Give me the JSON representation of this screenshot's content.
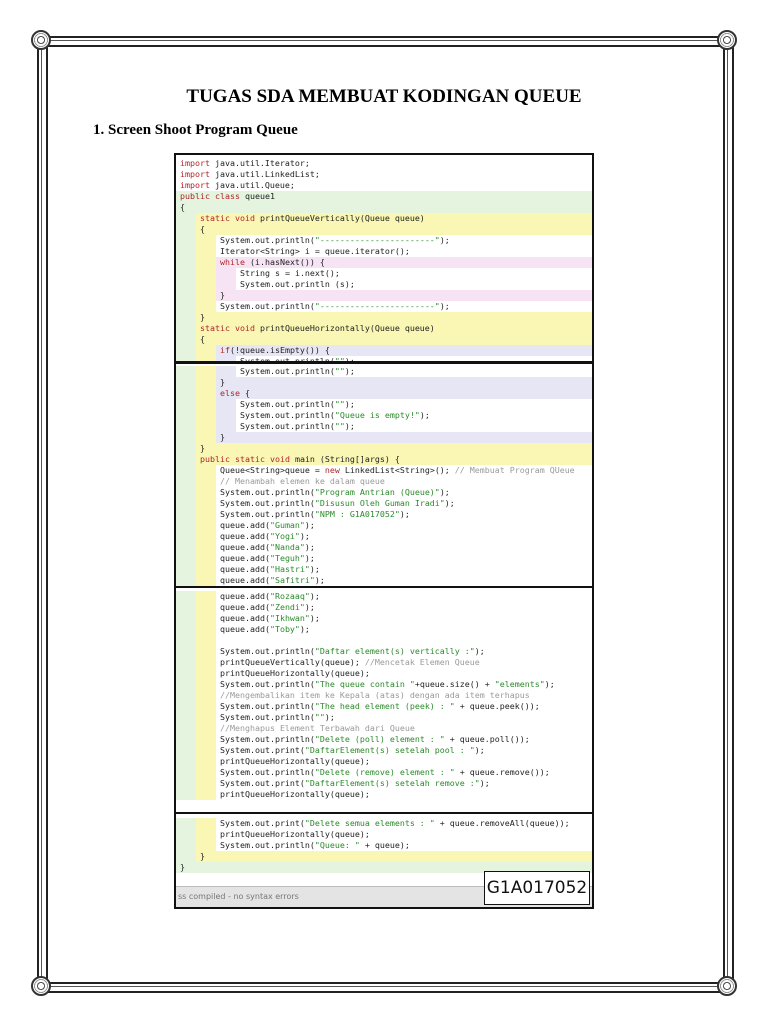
{
  "document": {
    "title": "TUGAS SDA MEMBUAT KODINGAN QUEUE",
    "section_heading": "1.  Screen Shoot Program Queue"
  },
  "colors": {
    "g": "#e4f4df",
    "y": "#f9f7b3",
    "w": "#ffffff",
    "p": "#f6e4f4",
    "l": "#e6e6f4"
  },
  "code_sections": [
    {
      "lines": [
        {
          "t": "import java.util.Iterator;",
          "i": 0,
          "bg": "w"
        },
        {
          "t": "import java.util.LinkedList;",
          "i": 0,
          "bg": "w"
        },
        {
          "t": "import java.util.Queue;",
          "i": 0,
          "bg": "w"
        },
        {
          "t": "public class queue1",
          "i": 0,
          "bg": "g"
        },
        {
          "t": "{",
          "i": 0,
          "bg": "g"
        },
        {
          "t": "static void printQueueVertically(Queue queue)",
          "i": 1,
          "bg": "gy"
        },
        {
          "t": "{",
          "i": 1,
          "bg": "gy"
        },
        {
          "t": "System.out.println(\"-----------------------\");",
          "i": 2,
          "bg": "gyw"
        },
        {
          "t": "Iterator<String> i = queue.iterator();",
          "i": 2,
          "bg": "gyw"
        },
        {
          "t": "while (i.hasNext()) {",
          "i": 2,
          "bg": "gyp"
        },
        {
          "t": "String s = i.next();",
          "i": 3,
          "bg": "gypw"
        },
        {
          "t": "System.out.println (s);",
          "i": 3,
          "bg": "gypw"
        },
        {
          "t": "}",
          "i": 2,
          "bg": "gyp"
        },
        {
          "t": "System.out.println(\"-----------------------\");",
          "i": 2,
          "bg": "gyw"
        },
        {
          "t": "}",
          "i": 1,
          "bg": "gy"
        },
        {
          "t": "static void printQueueHorizontally(Queue queue)",
          "i": 1,
          "bg": "gy"
        },
        {
          "t": "{",
          "i": 1,
          "bg": "gy"
        },
        {
          "t": "if(!queue.isEmpty()) {",
          "i": 2,
          "bg": "gyl"
        },
        {
          "t": "System.out.println(\"\");",
          "i": 3,
          "bg": "gylw"
        },
        {
          "t": "System.out.println(\"Queue elements : \" +queue);",
          "i": 3,
          "bg": "gylw"
        }
      ]
    },
    {
      "lines": [
        {
          "t": "System.out.println(\"\");",
          "i": 3,
          "bg": "gylw"
        },
        {
          "t": "}",
          "i": 2,
          "bg": "gyl"
        },
        {
          "t": "else {",
          "i": 2,
          "bg": "gyl"
        },
        {
          "t": "System.out.println(\"\");",
          "i": 3,
          "bg": "gylw"
        },
        {
          "t": "System.out.println(\"Queue is empty!\");",
          "i": 3,
          "bg": "gylw"
        },
        {
          "t": "System.out.println(\"\");",
          "i": 3,
          "bg": "gylw"
        },
        {
          "t": "}",
          "i": 2,
          "bg": "gyl"
        },
        {
          "t": "}",
          "i": 1,
          "bg": "gy"
        },
        {
          "t": "public static void main (String[]args) {",
          "i": 1,
          "bg": "gy"
        },
        {
          "t": "Queue<String>queue = new LinkedList<String>(); // Membuat Program QUeue",
          "i": 2,
          "bg": "gyw"
        },
        {
          "t": "// Menambah elemen ke dalam queue",
          "i": 2,
          "bg": "gyw"
        },
        {
          "t": "System.out.println(\"Program Antrian (Queue)\");",
          "i": 2,
          "bg": "gyw"
        },
        {
          "t": "System.out.println(\"Disusun Oleh Guman Iradi\");",
          "i": 2,
          "bg": "gyw"
        },
        {
          "t": "System.out.println(\"NPM : G1A017052\");",
          "i": 2,
          "bg": "gyw"
        },
        {
          "t": "queue.add(\"Guman\");",
          "i": 2,
          "bg": "gyw"
        },
        {
          "t": "queue.add(\"Yogi\");",
          "i": 2,
          "bg": "gyw"
        },
        {
          "t": "queue.add(\"Nanda\");",
          "i": 2,
          "bg": "gyw"
        },
        {
          "t": "queue.add(\"Teguh\");",
          "i": 2,
          "bg": "gyw"
        },
        {
          "t": "queue.add(\"Hastri\");",
          "i": 2,
          "bg": "gyw"
        },
        {
          "t": "queue.add(\"Safitri\");",
          "i": 2,
          "bg": "gyw"
        }
      ]
    },
    {
      "lines": [
        {
          "t": "queue.add(\"Rozaaq\");",
          "i": 2,
          "bg": "gyw"
        },
        {
          "t": "queue.add(\"Zendi\");",
          "i": 2,
          "bg": "gyw"
        },
        {
          "t": "queue.add(\"Ikhwan\");",
          "i": 2,
          "bg": "gyw"
        },
        {
          "t": "queue.add(\"Toby\");",
          "i": 2,
          "bg": "gyw"
        },
        {
          "t": "",
          "i": 2,
          "bg": "gyw"
        },
        {
          "t": "System.out.println(\"Daftar element(s) vertically :\");",
          "i": 2,
          "bg": "gyw"
        },
        {
          "t": "printQueueVertically(queue); //Mencetak Elemen Queue",
          "i": 2,
          "bg": "gyw"
        },
        {
          "t": "printQueueHorizontally(queue);",
          "i": 2,
          "bg": "gyw"
        },
        {
          "t": "System.out.println(\"The queue contain \"+queue.size() + \"elements\");",
          "i": 2,
          "bg": "gyw"
        },
        {
          "t": "//Mengembalikan item ke Kepala (atas) dengan ada item terhapus",
          "i": 2,
          "bg": "gyw"
        },
        {
          "t": "System.out.println(\"The head element (peek) : \" + queue.peek());",
          "i": 2,
          "bg": "gyw"
        },
        {
          "t": "System.out.println(\"\");",
          "i": 2,
          "bg": "gyw"
        },
        {
          "t": "//Menghapus Element Terbawah dari Queue",
          "i": 2,
          "bg": "gyw"
        },
        {
          "t": "System.out.println(\"Delete (poll) element : \" + queue.poll());",
          "i": 2,
          "bg": "gyw"
        },
        {
          "t": "System.out.print(\"DaftarElement(s) setelah pool : \");",
          "i": 2,
          "bg": "gyw"
        },
        {
          "t": "printQueueHorizontally(queue);",
          "i": 2,
          "bg": "gyw"
        },
        {
          "t": "System.out.println(\"Delete (remove) element : \" + queue.remove());",
          "i": 2,
          "bg": "gyw"
        },
        {
          "t": "System.out.print(\"DaftarElement(s) setelah remove :\");",
          "i": 2,
          "bg": "gyw"
        },
        {
          "t": "printQueueHorizontally(queue);",
          "i": 2,
          "bg": "gyw"
        }
      ]
    },
    {
      "lines": [
        {
          "t": "System.out.print(\"Delete semua elements : \" + queue.removeAll(queue));",
          "i": 2,
          "bg": "gyw"
        },
        {
          "t": "printQueueHorizontally(queue);",
          "i": 2,
          "bg": "gyw"
        },
        {
          "t": "System.out.println(\"Queue: \" + queue);",
          "i": 2,
          "bg": "gyw"
        },
        {
          "t": "}",
          "i": 1,
          "bg": "gy"
        },
        {
          "t": "}",
          "i": 0,
          "bg": "g"
        }
      ]
    }
  ],
  "status_bar": {
    "text": "ss compiled - no syntax errors"
  },
  "npm_label": "G1A017052"
}
